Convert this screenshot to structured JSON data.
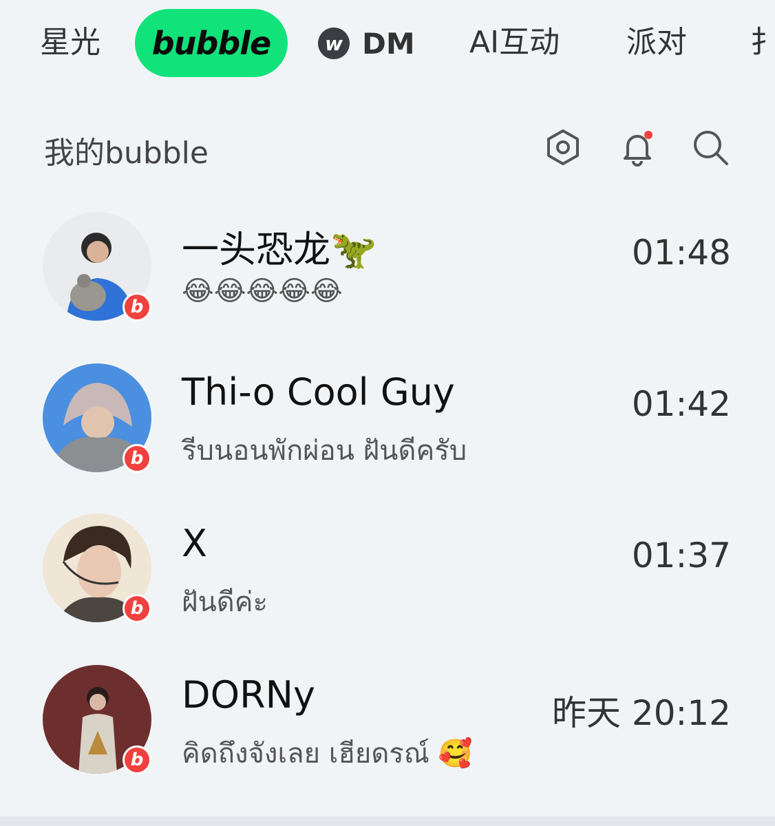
{
  "tabs": {
    "items": [
      "星光",
      "bubble",
      "DM",
      "AI互动",
      "派对",
      "扌"
    ],
    "dm_logo": "w",
    "active_color": "#12e27a"
  },
  "header": {
    "title": "我的bubble",
    "icons": [
      "settings-hex-icon",
      "bell-icon",
      "search-icon"
    ]
  },
  "chats": [
    {
      "name": "一头恐龙🦖",
      "message": "😂😂😂😂😂",
      "time": "01:48",
      "badge": "b"
    },
    {
      "name": "Thi-o Cool Guy",
      "message": "รีบนอนพักผ่อน ฝันดีครับ",
      "time": "01:42",
      "badge": "b"
    },
    {
      "name": "X",
      "message": "ฝันดีค่ะ",
      "time": "01:37",
      "badge": "b"
    },
    {
      "name": "DORNy",
      "message": "คิดถึงจังเลย เฮียดรณ์ 🥰",
      "time": "昨天 20:12",
      "badge": "b"
    }
  ],
  "colors": {
    "badge": "#f0413e",
    "background": "#f1f4f7",
    "notify_dot": "#f0413e"
  }
}
